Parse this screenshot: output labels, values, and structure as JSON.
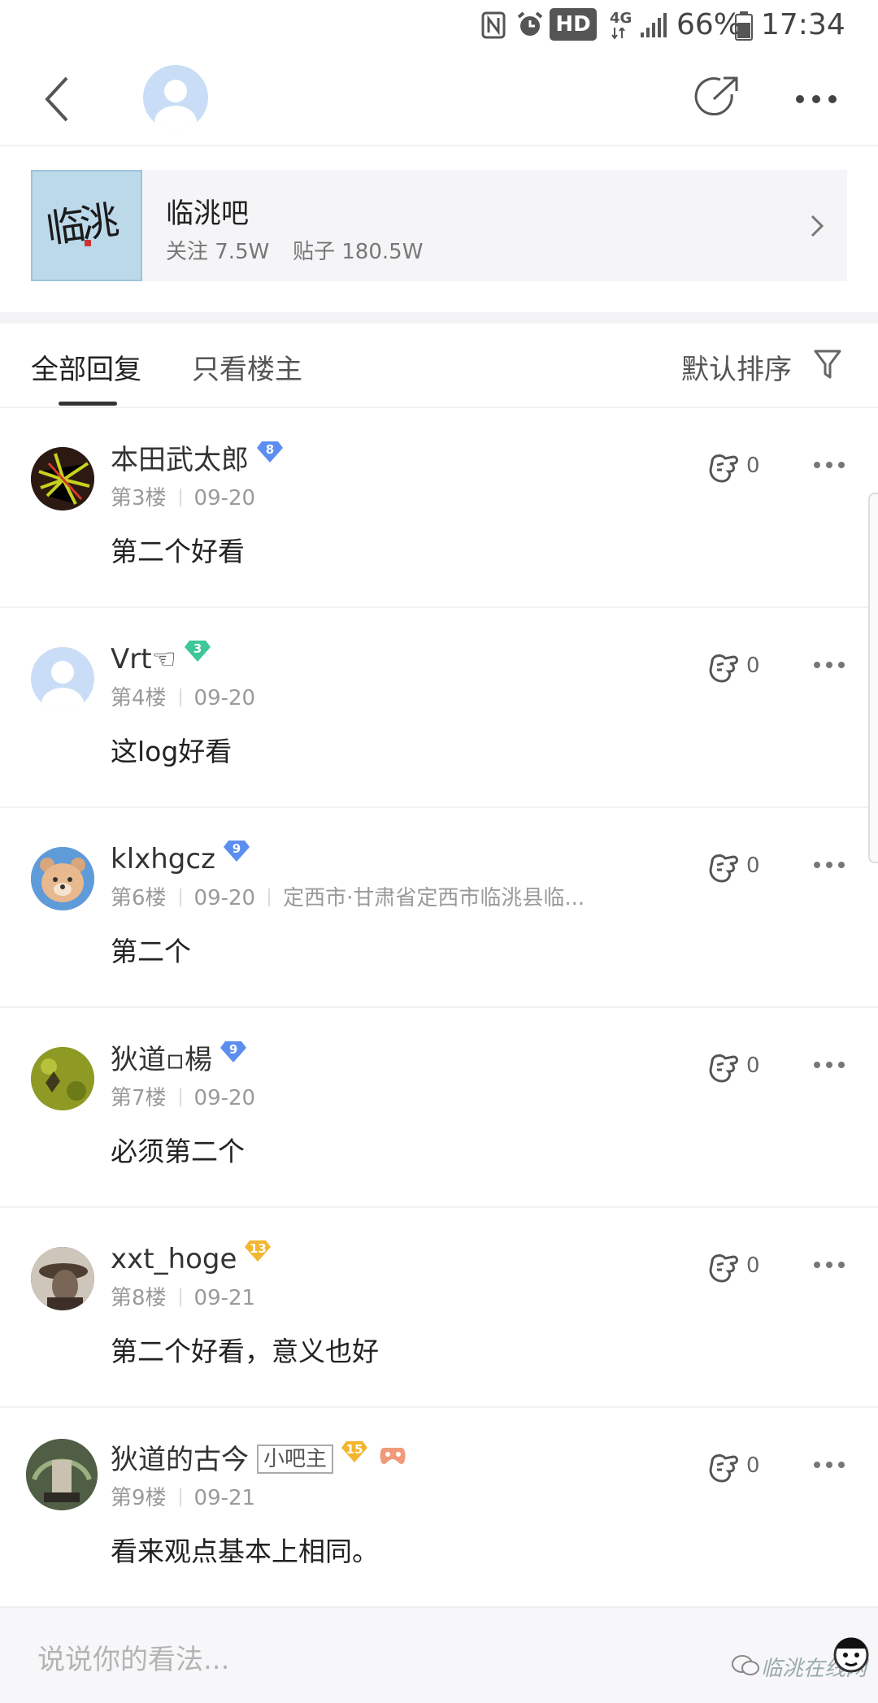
{
  "status_bar": {
    "hd": "HD",
    "network": "4G",
    "battery": "66%",
    "time": "17:34"
  },
  "forum": {
    "name": "临洮吧",
    "logo_text": "临洮",
    "follow": "关注 7.5W",
    "posts": "贴子 180.5W"
  },
  "tabs": {
    "all": "全部回复",
    "op_only": "只看楼主",
    "sort": "默认排序"
  },
  "posts": [
    {
      "name": "本田武太郎",
      "level": "8",
      "floor": "第3楼",
      "date": "09-20",
      "content": "第二个好看",
      "likes": "0"
    },
    {
      "name": "Vrt☜",
      "level": "3",
      "floor": "第4楼",
      "date": "09-20",
      "content": "这log好看",
      "likes": "0"
    },
    {
      "name": "klxhgcz",
      "level": "9",
      "floor": "第6楼",
      "date": "09-20",
      "location": "定西市·甘肃省定西市临洮县临...",
      "content": "第二个",
      "likes": "0"
    },
    {
      "name": "狄道▫楊",
      "level": "9",
      "floor": "第7楼",
      "date": "09-20",
      "content": "必须第二个",
      "likes": "0"
    },
    {
      "name": "xxt_hoge",
      "level": "13",
      "floor": "第8楼",
      "date": "09-21",
      "content": "第二个好看，意义也好",
      "likes": "0"
    },
    {
      "name": "狄道的古今",
      "tag": "小吧主",
      "level": "15",
      "floor": "第9楼",
      "date": "09-21",
      "content": "看来观点基本上相同。",
      "likes": "0"
    }
  ],
  "comment": {
    "placeholder": "说说你的看法...",
    "watermark": "临洮在线网"
  },
  "colors": {
    "badge_blue": "#5b8ef0",
    "badge_green": "#3ec79a",
    "badge_gold": "#f2b62f"
  }
}
